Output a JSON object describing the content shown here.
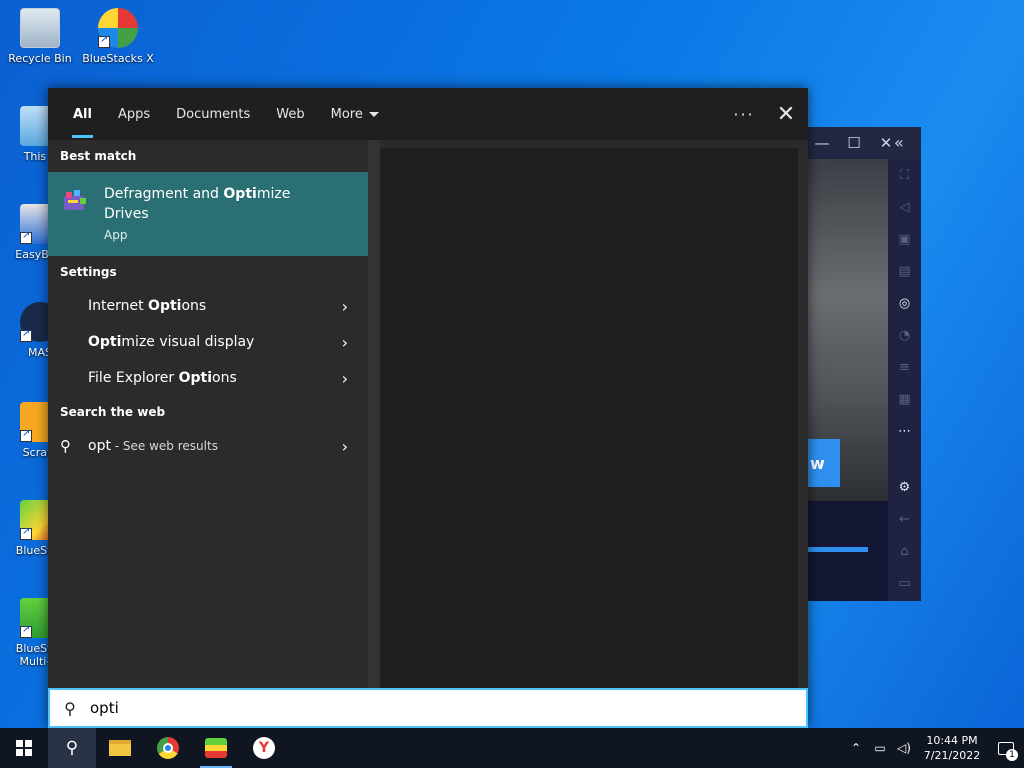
{
  "desktop": {
    "icons": [
      {
        "label": "Recycle Bin"
      },
      {
        "label": "BlueStacks X"
      },
      {
        "label": "This P"
      },
      {
        "label": "EasyBCD"
      },
      {
        "label": "MAS"
      },
      {
        "label": "Scratc"
      },
      {
        "label": "BlueStac"
      },
      {
        "label": "BlueStac\nMulti-In"
      }
    ]
  },
  "search": {
    "tabs": [
      "All",
      "Apps",
      "Documents",
      "Web",
      "More"
    ],
    "active_tab": "All",
    "more_dots": "···",
    "close": "✕",
    "best_match_heading": "Best match",
    "best_match": {
      "title_pre": "Defragment and ",
      "title_hl": "Opti",
      "title_post": "mize",
      "title_line2": "Drives",
      "subtitle": "App"
    },
    "settings_heading": "Settings",
    "settings": [
      {
        "pre": "Internet ",
        "hl": "Opti",
        "post": "ons"
      },
      {
        "pre": "",
        "hl": "Opti",
        "post": "mize visual display"
      },
      {
        "pre": "File Explorer ",
        "hl": "Opti",
        "post": "ons"
      }
    ],
    "web_heading": "Search the web",
    "web": {
      "query": "opt",
      "suffix": " - See web results"
    },
    "query_value": "opti"
  },
  "bluestacks": {
    "title_buttons": [
      "—",
      "☐",
      "✕",
      "«"
    ],
    "button_text": "w"
  },
  "taskbar": {
    "apps": [
      "start",
      "search",
      "file-explorer",
      "chrome",
      "bluestacks",
      "yandex"
    ],
    "clock_time": "10:44 PM",
    "clock_date": "7/21/2022",
    "notification_count": "1"
  },
  "colors": {
    "accent": "#4cc2ff",
    "best_match_bg": "#2a6f73",
    "desktop": "#0a78e6"
  }
}
